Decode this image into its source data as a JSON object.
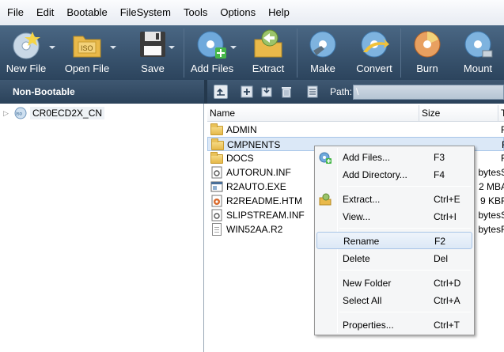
{
  "menubar": [
    "File",
    "Edit",
    "Bootable",
    "FileSystem",
    "Tools",
    "Options",
    "Help"
  ],
  "toolbar": {
    "new_file": "New File",
    "open_file": "Open File",
    "save": "Save",
    "add_files": "Add Files",
    "extract": "Extract",
    "make": "Make",
    "convert": "Convert",
    "burn": "Burn",
    "mount": "Mount"
  },
  "secondbar": {
    "label": "Non-Bootable",
    "path_label": "Path:",
    "path_value": "\\"
  },
  "tree": {
    "root": "CR0ECD2X_CN"
  },
  "filelist": {
    "columns": [
      "Name",
      "Size",
      "T"
    ],
    "rows": [
      {
        "name": "ADMIN",
        "size": "",
        "type": "F",
        "kind": "folder"
      },
      {
        "name": "CMPNENTS",
        "size": "",
        "type": "F",
        "kind": "folder"
      },
      {
        "name": "DOCS",
        "size": "",
        "type": "F",
        "kind": "folder"
      },
      {
        "name": "AUTORUN.INF",
        "size": "bytes",
        "type": "S",
        "kind": "inf"
      },
      {
        "name": "R2AUTO.EXE",
        "size": "2 MB",
        "type": "A",
        "kind": "exe"
      },
      {
        "name": "R2README.HTM",
        "size": "9 KB",
        "type": "F",
        "kind": "htm"
      },
      {
        "name": "SLIPSTREAM.INF",
        "size": "bytes",
        "type": "S",
        "kind": "inf"
      },
      {
        "name": "WIN52AA.R2",
        "size": "bytes",
        "type": "F",
        "kind": "file"
      }
    ]
  },
  "context_menu": {
    "items": [
      {
        "label": "Add Files...",
        "shortcut": "F3"
      },
      {
        "label": "Add Directory...",
        "shortcut": "F4"
      },
      {
        "label": "Extract...",
        "shortcut": "Ctrl+E"
      },
      {
        "label": "View...",
        "shortcut": "Ctrl+I"
      },
      {
        "label": "Rename",
        "shortcut": "F2"
      },
      {
        "label": "Delete",
        "shortcut": "Del"
      },
      {
        "label": "New Folder",
        "shortcut": "Ctrl+D"
      },
      {
        "label": "Select All",
        "shortcut": "Ctrl+A"
      },
      {
        "label": "Properties...",
        "shortcut": "Ctrl+T"
      }
    ]
  },
  "colors": {
    "toolbar_bg": "#3a5470",
    "selection": "#dbe8f7",
    "menu_bg": "#f5f6f7"
  }
}
